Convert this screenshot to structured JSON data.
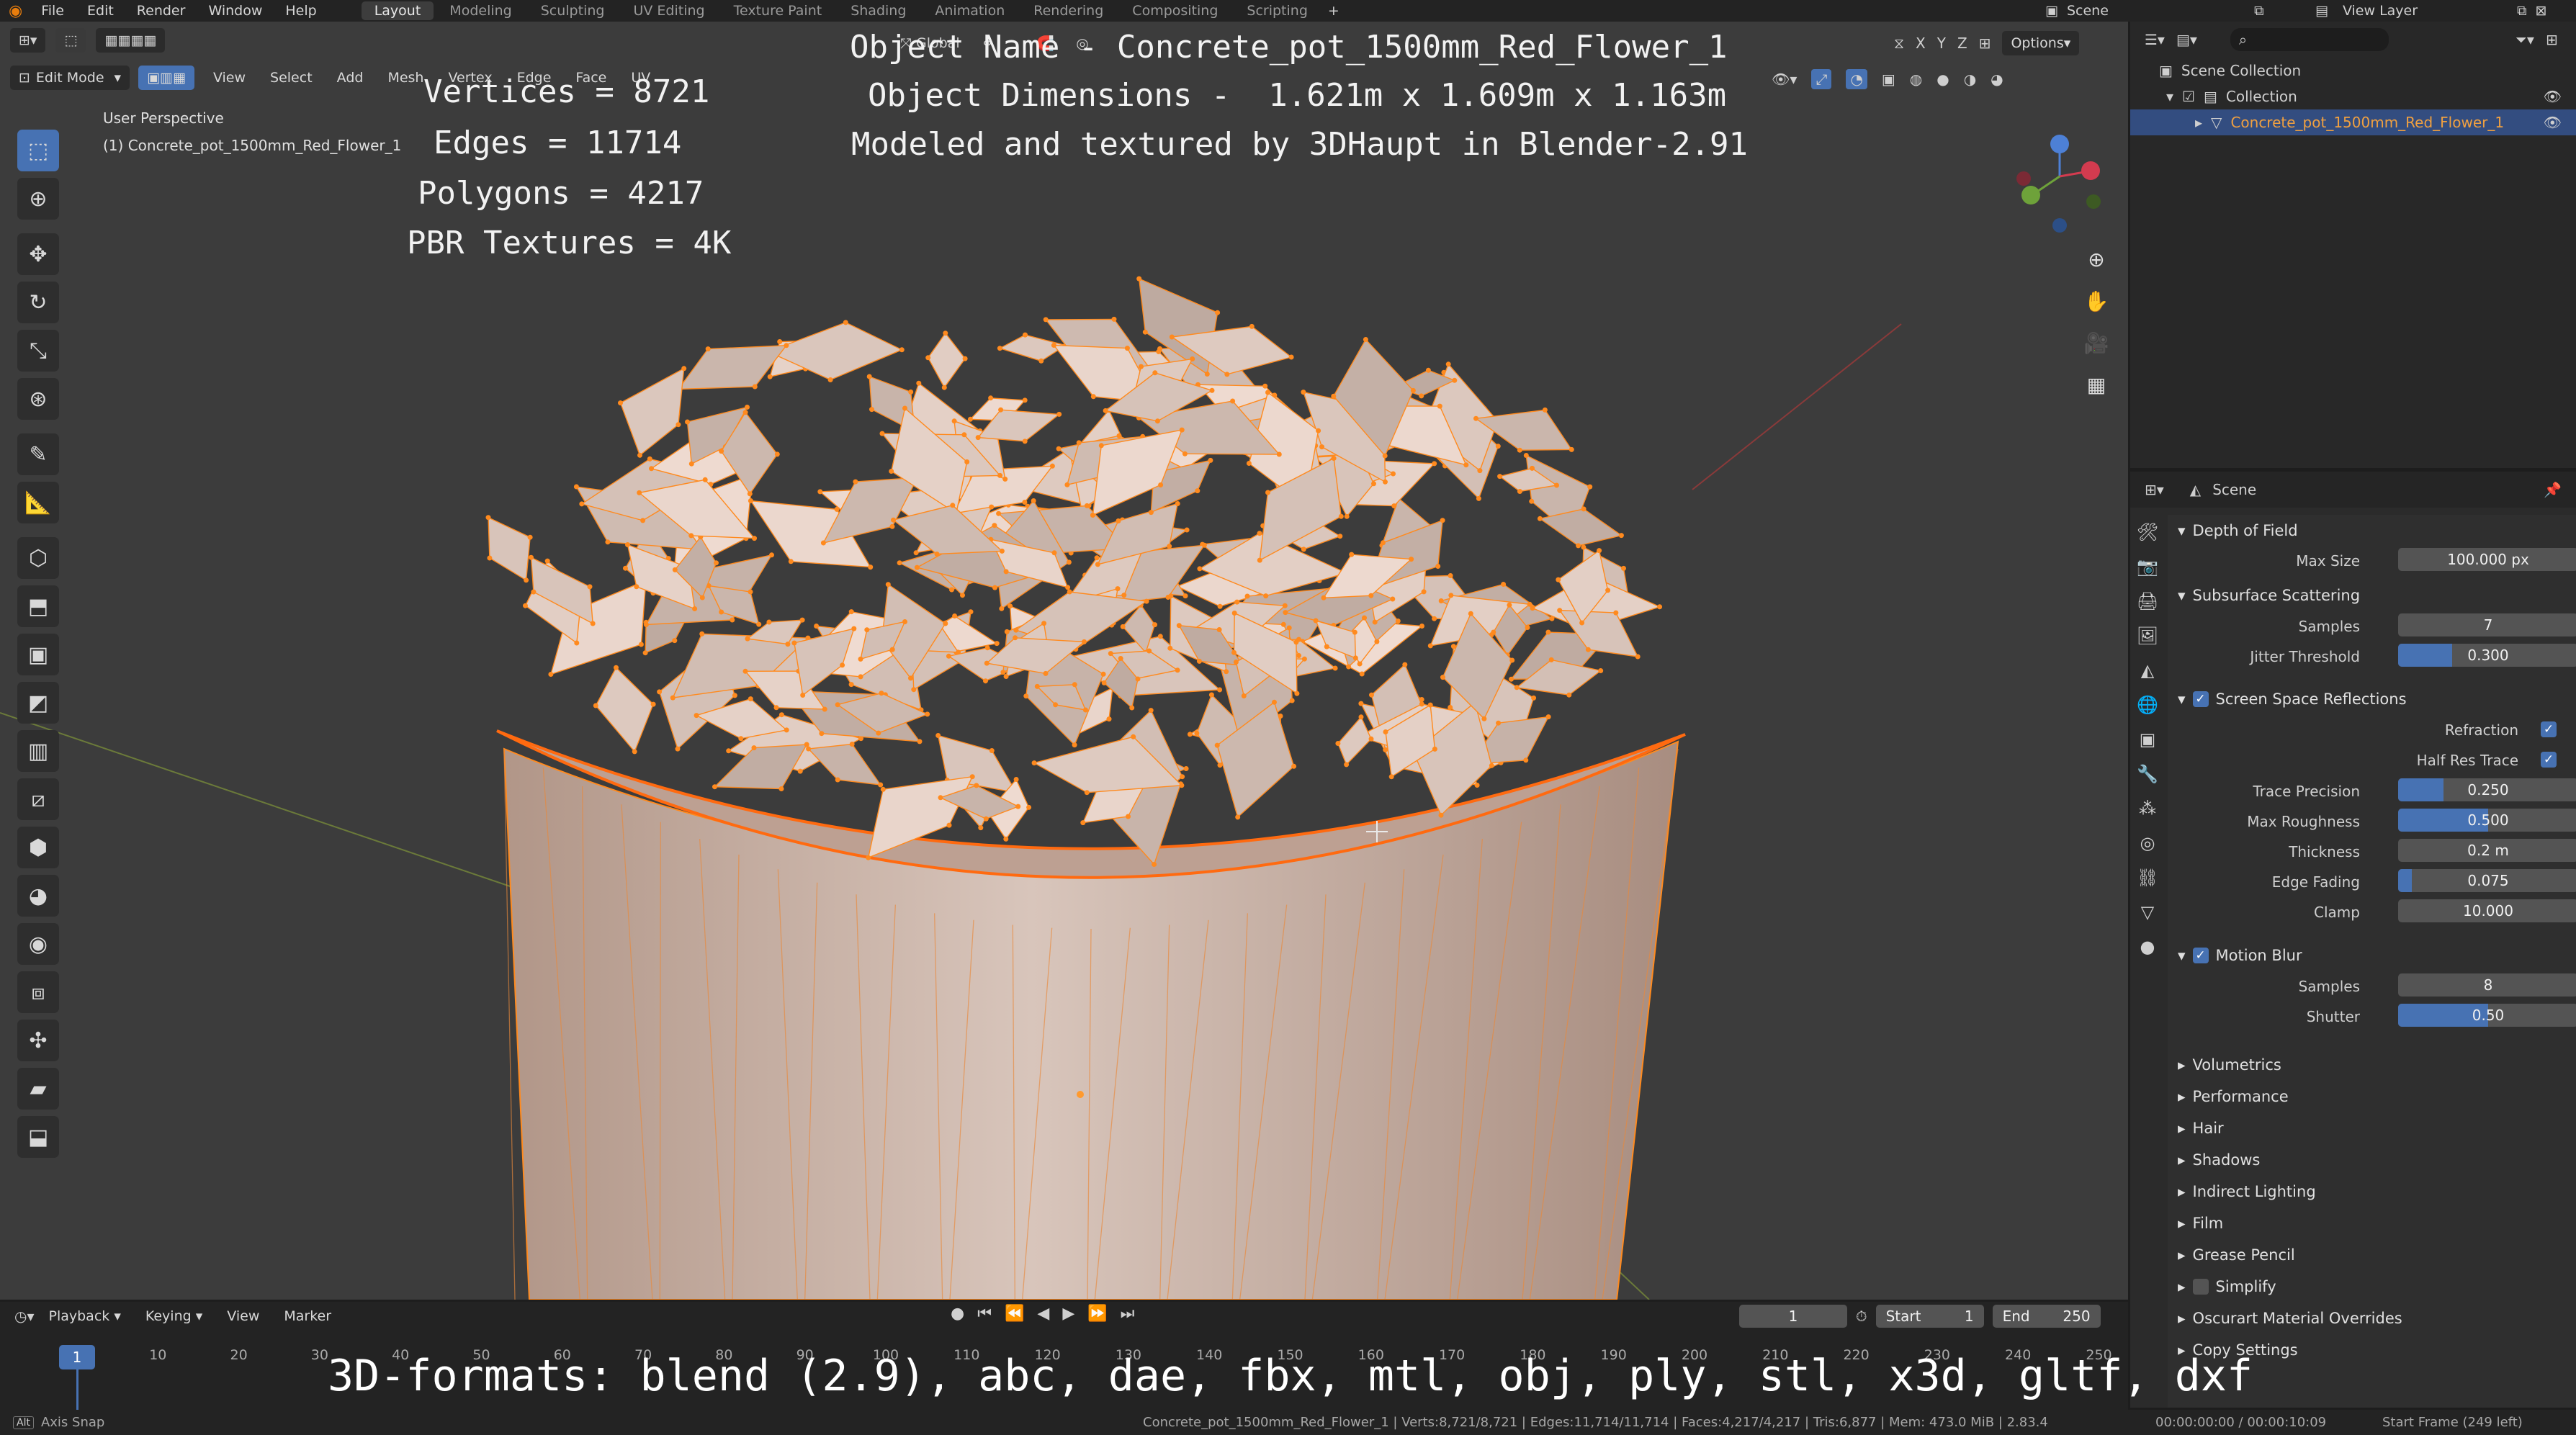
{
  "topbar": {
    "menus": [
      "File",
      "Edit",
      "Render",
      "Window",
      "Help"
    ],
    "workspaces": [
      "Layout",
      "Modeling",
      "Sculpting",
      "UV Editing",
      "Texture Paint",
      "Shading",
      "Animation",
      "Rendering",
      "Compositing",
      "Scripting"
    ],
    "active_workspace": "Layout",
    "scene": "Scene",
    "view_layer": "View Layer"
  },
  "viewport_header": {
    "mode": "Edit Mode",
    "menus": [
      "View",
      "Select",
      "Add",
      "Mesh",
      "Vertex",
      "Edge",
      "Face",
      "UV"
    ],
    "orientation": "Global",
    "axes": [
      "X",
      "Y",
      "Z"
    ],
    "options": "Options"
  },
  "viewport": {
    "view_name": "User Perspective",
    "object_label": "(1) Concrete_pot_1500mm_Red_Flower_1"
  },
  "overlay": {
    "object_name": "Object Name - Concrete_pot_1500mm_Red_Flower_1",
    "dimensions": "Object Dimensions -  1.621m x 1.609m x 1.163m",
    "credit": "Modeled and textured by 3DHaupt in Blender-2.91",
    "vertices": "Vertices = 8721",
    "edges": "Edges = 11714",
    "polygons": "Polygons = 4217",
    "textures": "PBR Textures = 4K",
    "formats": "3D-formats: blend (2.9), abc, dae, fbx, mtl, obj, ply, stl, x3d, gltf, dxf"
  },
  "outliner": {
    "search_placeholder": "",
    "root": "Scene Collection",
    "collection": "Collection",
    "object": "Concrete_pot_1500mm_Red_Flower_1"
  },
  "properties": {
    "context": "Scene",
    "sections": {
      "dof": {
        "title": "Depth of Field",
        "max_size_label": "Max Size",
        "max_size": "100.000 px"
      },
      "sss": {
        "title": "Subsurface Scattering",
        "samples_label": "Samples",
        "samples": "7",
        "jitter_label": "Jitter Threshold",
        "jitter": "0.300",
        "jitter_fill": 0.3
      },
      "ssr": {
        "title": "Screen Space Reflections",
        "refraction_label": "Refraction",
        "half_res_label": "Half Res Trace",
        "trace_precision_label": "Trace Precision",
        "trace_precision": "0.250",
        "trace_precision_fill": 0.25,
        "max_roughness_label": "Max Roughness",
        "max_roughness": "0.500",
        "max_roughness_fill": 0.5,
        "thickness_label": "Thickness",
        "thickness": "0.2 m",
        "edge_fading_label": "Edge Fading",
        "edge_fading": "0.075",
        "edge_fading_fill": 0.075,
        "clamp_label": "Clamp",
        "clamp": "10.000"
      },
      "motion_blur": {
        "title": "Motion Blur",
        "samples_label": "Samples",
        "samples": "8",
        "shutter_label": "Shutter",
        "shutter": "0.50",
        "shutter_fill": 0.5
      }
    },
    "collapsed": [
      "Volumetrics",
      "Performance",
      "Hair",
      "Shadows",
      "Indirect Lighting",
      "Film",
      "Grease Pencil",
      "Simplify",
      "Oscurart Material Overrides",
      "Copy Settings"
    ]
  },
  "timeline": {
    "menus": [
      "Playback",
      "Keying",
      "View",
      "Marker"
    ],
    "current_frame": "1",
    "start_label": "Start",
    "start": "1",
    "end_label": "End",
    "end": "250",
    "ruler": [
      "10",
      "20",
      "30",
      "40",
      "50",
      "60",
      "70",
      "80",
      "90",
      "100",
      "110",
      "120",
      "130",
      "140",
      "150",
      "160",
      "170",
      "180",
      "190",
      "200",
      "210",
      "220",
      "230",
      "240",
      "250"
    ],
    "playhead": "1"
  },
  "statusbar": {
    "left": "Axis Snap",
    "stats": "Concrete_pot_1500mm_Red_Flower_1 | Verts:8,721/8,721 | Edges:11,714/11,714 | Faces:4,217/4,217 | Tris:6,877 | Mem: 473.0 MiB | 2.83.4",
    "time": "00:00:00:00 / 00:00:10:09",
    "frame": "Start Frame (249 left)"
  },
  "colors": {
    "accent": "#4772b3",
    "mesh": "#c4a99b",
    "wire": "#ff8a1e"
  }
}
